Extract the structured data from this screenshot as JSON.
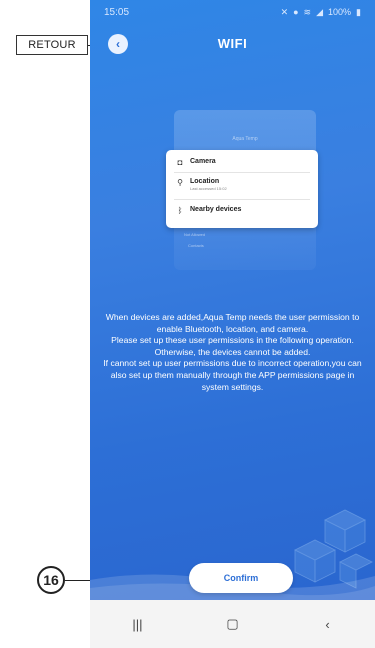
{
  "callouts": {
    "back_label": "RETOUR",
    "confirm_number": "16"
  },
  "status_bar": {
    "time": "15:05",
    "battery": "100%"
  },
  "header": {
    "title": "WIFI"
  },
  "illustration": {
    "top_text": "Aqua Temp",
    "permissions": [
      {
        "label": "Camera",
        "sub": ""
      },
      {
        "label": "Location",
        "sub": "Last accessed 15:02"
      },
      {
        "label": "Nearby devices",
        "sub": ""
      }
    ],
    "low_text_1": "Not Allowed",
    "low_text_2": "Contacts"
  },
  "info": [
    "When devices are added,Aqua Temp needs the user permission to enable Bluetooth, location, and camera.",
    "Please set up these user permissions in the following operation.",
    "Otherwise, the devices cannot be added.",
    "If cannot set up user permissions due to incorrect operation,you can also set up them manually through the APP permissions page in system settings."
  ],
  "buttons": {
    "confirm": "Confirm"
  },
  "colors": {
    "primary": "#2d6fd6",
    "background_top": "#2f86e6"
  },
  "icons": {
    "back": "chevron-left-icon",
    "nav_recent": "recent-apps-icon",
    "nav_home": "home-icon",
    "nav_back": "nav-back-icon"
  }
}
